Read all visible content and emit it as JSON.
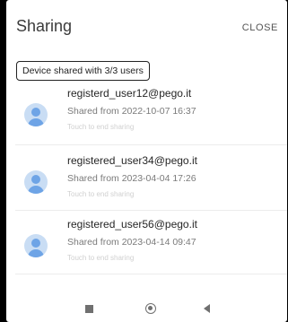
{
  "dialog": {
    "title": "Sharing",
    "close_label": "CLOSE",
    "summary": "Device shared with 3/3 users"
  },
  "users": [
    {
      "email": "registerd_user12@pego.it",
      "shared": "Shared from 2022-10-07 16:37",
      "hint": "Touch to end sharing"
    },
    {
      "email": "registered_user34@pego.it",
      "shared": "Shared from 2023-04-04 17:26",
      "hint": "Touch to end sharing"
    },
    {
      "email": "registered_user56@pego.it",
      "shared": "Shared from 2023-04-14 09:47",
      "hint": "Touch to end sharing"
    }
  ],
  "icons": {
    "avatar": "user-avatar-icon",
    "nav_recents": "square-recents-icon",
    "nav_home": "circle-home-icon",
    "nav_back": "triangle-back-icon"
  },
  "colors": {
    "avatar_bg": "#c9ddf4",
    "avatar_fg": "#6ea4e6",
    "backdrop": "#000000"
  }
}
